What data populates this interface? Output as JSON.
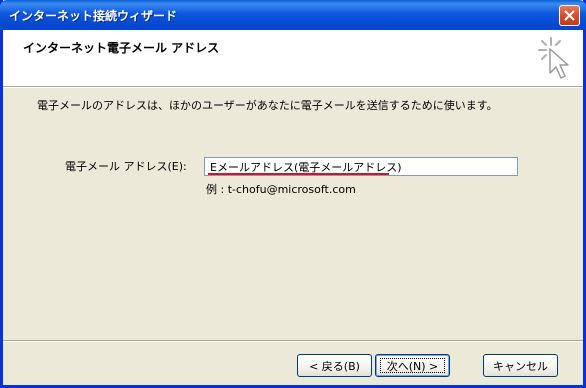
{
  "window": {
    "title": "インターネット接続ウィザード"
  },
  "header": {
    "title": "インターネット電子メール アドレス"
  },
  "body": {
    "description": "電子メールのアドレスは、ほかのユーザーがあなたに電子メールを送信するために使います。",
    "email_label": "電子メール アドレス(E):",
    "email_value": "Eメールアドレス(電子メールアドレス)",
    "example": "例 : t-chofu@microsoft.com"
  },
  "buttons": {
    "back": "< 戻る(B)",
    "next": "次へ(N) >",
    "cancel": "キャンセル"
  },
  "colors": {
    "titlebar": "#0a46c8",
    "dialog": "#ece9d8",
    "underline": "#e0101a"
  }
}
